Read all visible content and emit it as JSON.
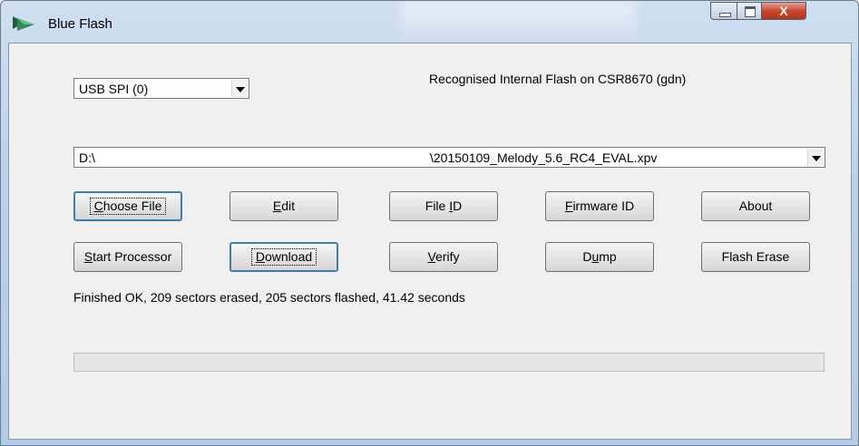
{
  "window": {
    "title": "Blue Flash",
    "close_glyph": "X"
  },
  "port_select": {
    "value": "USB SPI (0)"
  },
  "status_top": "Recognised Internal Flash on CSR8670 (gdn)",
  "file_select": {
    "drive": "D:\\",
    "path": "\\20150109_Melody_5.6_RC4_EVAL.xpv"
  },
  "buttons_row1": [
    {
      "pre": "",
      "key": "C",
      "post": "hoose File"
    },
    {
      "pre": "",
      "key": "E",
      "post": "dit"
    },
    {
      "pre": "File ",
      "key": "I",
      "post": "D"
    },
    {
      "pre": "",
      "key": "F",
      "post": "irmware ID"
    },
    {
      "pre": "About",
      "key": "",
      "post": ""
    }
  ],
  "buttons_row2": [
    {
      "pre": "",
      "key": "S",
      "post": "tart Processor"
    },
    {
      "pre": "",
      "key": "D",
      "post": "ownload"
    },
    {
      "pre": "",
      "key": "V",
      "post": "erify"
    },
    {
      "pre": "D",
      "key": "u",
      "post": "mp"
    },
    {
      "pre": "Flash Erase",
      "key": "",
      "post": ""
    }
  ],
  "status_message": "Finished OK, 209 sectors erased, 205 sectors flashed, 41.42 seconds",
  "progress": {
    "value_percent": 0
  },
  "colors": {
    "titlebar": "#bcd2ea",
    "focus_border": "#3c7fb1",
    "progress_fill": "#06b025"
  }
}
